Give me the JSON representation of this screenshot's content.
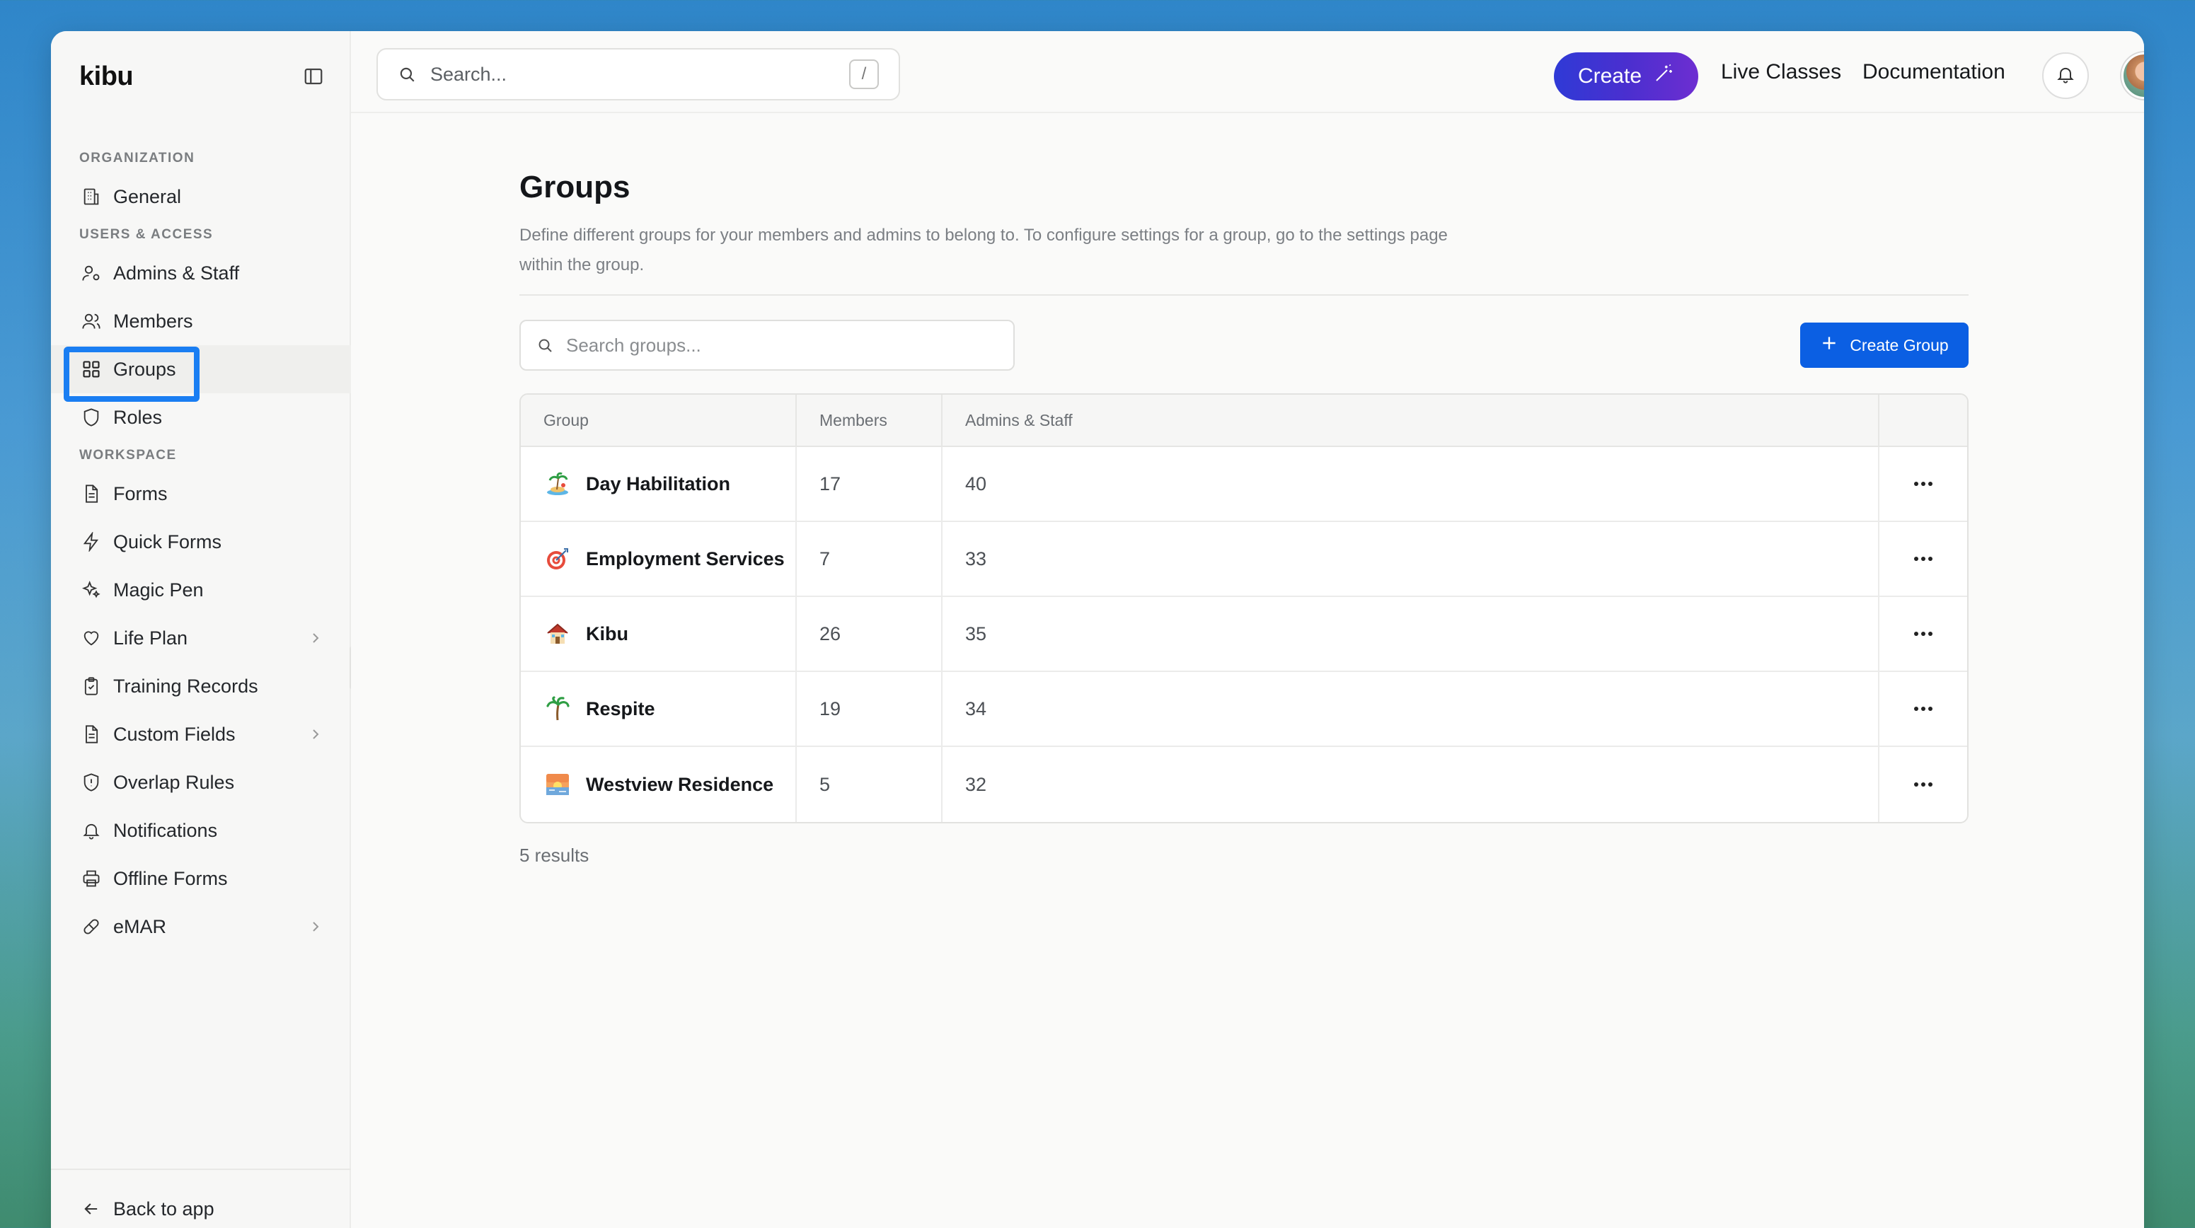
{
  "app": {
    "brand": "kibu"
  },
  "colors": {
    "accent": "#0b5fe3",
    "create_gradient_start": "#2f3ad6",
    "create_gradient_end": "#6d2ed1",
    "highlight": "#1a7ef2"
  },
  "topbar": {
    "search_placeholder": "Search...",
    "search_shortcut": "/",
    "create_label": "Create",
    "links": [
      "Live Classes",
      "Documentation"
    ]
  },
  "sidebar": {
    "sections": [
      {
        "label": "Organization",
        "items": [
          {
            "label": "General",
            "icon": "building-icon",
            "chevron": false
          }
        ]
      },
      {
        "label": "Users & Access",
        "items": [
          {
            "label": "Admins & Staff",
            "icon": "user-gear-icon",
            "chevron": false
          },
          {
            "label": "Members",
            "icon": "users-icon",
            "chevron": false
          },
          {
            "label": "Groups",
            "icon": "grid-icon",
            "chevron": false,
            "active": true
          },
          {
            "label": "Roles",
            "icon": "shield-icon",
            "chevron": false
          }
        ]
      },
      {
        "label": "Workspace",
        "items": [
          {
            "label": "Forms",
            "icon": "document-icon",
            "chevron": false
          },
          {
            "label": "Quick Forms",
            "icon": "lightning-icon",
            "chevron": false
          },
          {
            "label": "Magic Pen",
            "icon": "sparkles-icon",
            "chevron": false
          },
          {
            "label": "Life Plan",
            "icon": "heart-icon",
            "chevron": true
          },
          {
            "label": "Training Records",
            "icon": "clipboard-check-icon",
            "chevron": false
          },
          {
            "label": "Custom Fields",
            "icon": "document-icon",
            "chevron": true
          },
          {
            "label": "Overlap Rules",
            "icon": "shield-alert-icon",
            "chevron": false
          },
          {
            "label": "Notifications",
            "icon": "bell-icon",
            "chevron": false
          },
          {
            "label": "Offline Forms",
            "icon": "printer-icon",
            "chevron": false
          },
          {
            "label": "eMAR",
            "icon": "pill-icon",
            "chevron": true
          }
        ]
      }
    ],
    "footer_label": "Back to app"
  },
  "page": {
    "title": "Groups",
    "description": "Define different groups for your members and admins to belong to. To configure settings for a group, go to the settings page within the group.",
    "search_placeholder": "Search groups...",
    "create_button": "Create Group",
    "columns": [
      "Group",
      "Members",
      "Admins & Staff"
    ],
    "rows": [
      {
        "emoji": "🏝️",
        "name": "Day Habilitation",
        "members": "17",
        "admins": "40"
      },
      {
        "emoji": "🎯",
        "name": "Employment Services",
        "members": "7",
        "admins": "33"
      },
      {
        "emoji": "🏠",
        "name": "Kibu",
        "members": "26",
        "admins": "35"
      },
      {
        "emoji": "🌴",
        "name": "Respite",
        "members": "19",
        "admins": "34"
      },
      {
        "emoji": "🌅",
        "name": "Westview Residence",
        "members": "5",
        "admins": "32"
      }
    ],
    "results_text": "5 results"
  }
}
